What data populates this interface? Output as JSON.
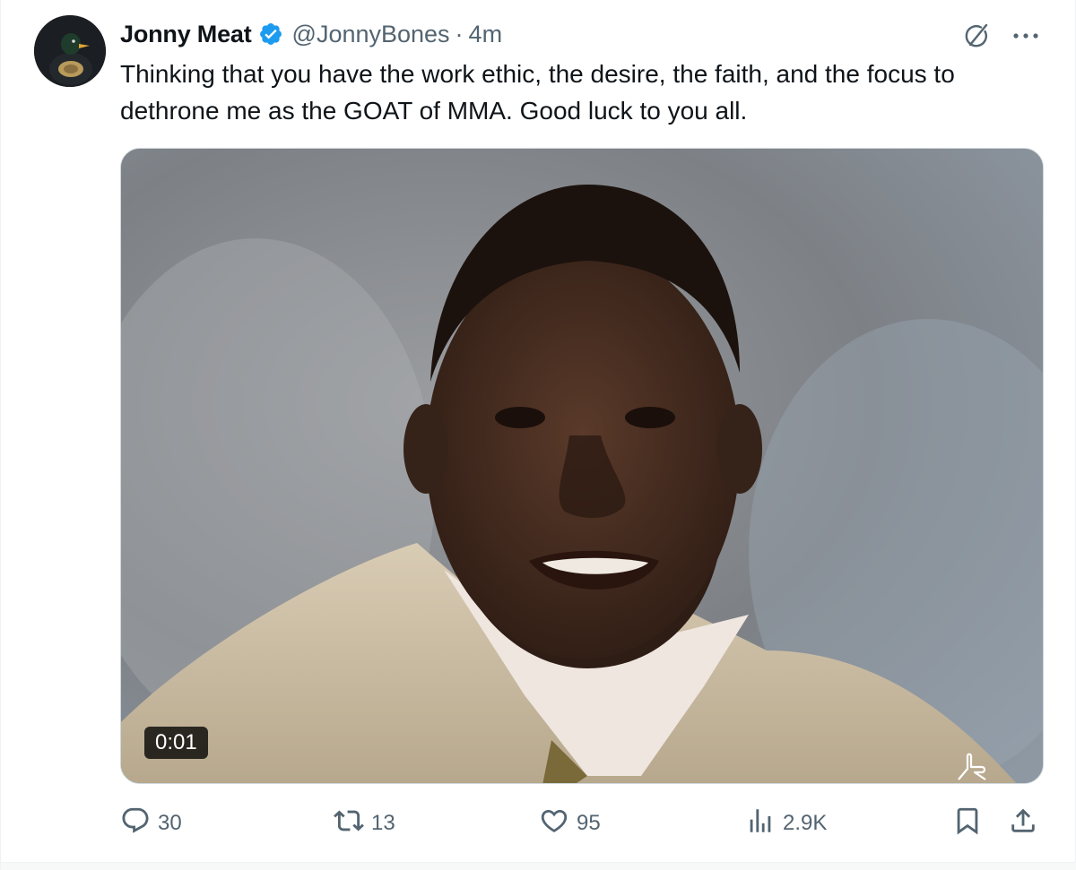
{
  "tweet": {
    "author": {
      "display_name": "Jonny Meat",
      "handle": "@JonnyBones",
      "verified": true,
      "verified_color": "#1d9bf0"
    },
    "separator": "·",
    "time": "4m",
    "text": "Thinking that you have the work ethic, the desire, the faith, and the focus to dethrone me as the GOAT of MMA. Good luck to you all.",
    "media": {
      "type": "video",
      "duration": "0:01"
    },
    "actions": {
      "replies": "30",
      "reposts": "13",
      "likes": "95",
      "views": "2.9K"
    },
    "icons": {
      "grok": "grok-icon",
      "more": "more-icon",
      "reply": "reply-icon",
      "repost": "repost-icon",
      "like": "like-icon",
      "views": "views-icon",
      "bookmark": "bookmark-icon",
      "share": "share-icon"
    },
    "colors": {
      "text": "#0f1419",
      "muted": "#536471"
    }
  }
}
